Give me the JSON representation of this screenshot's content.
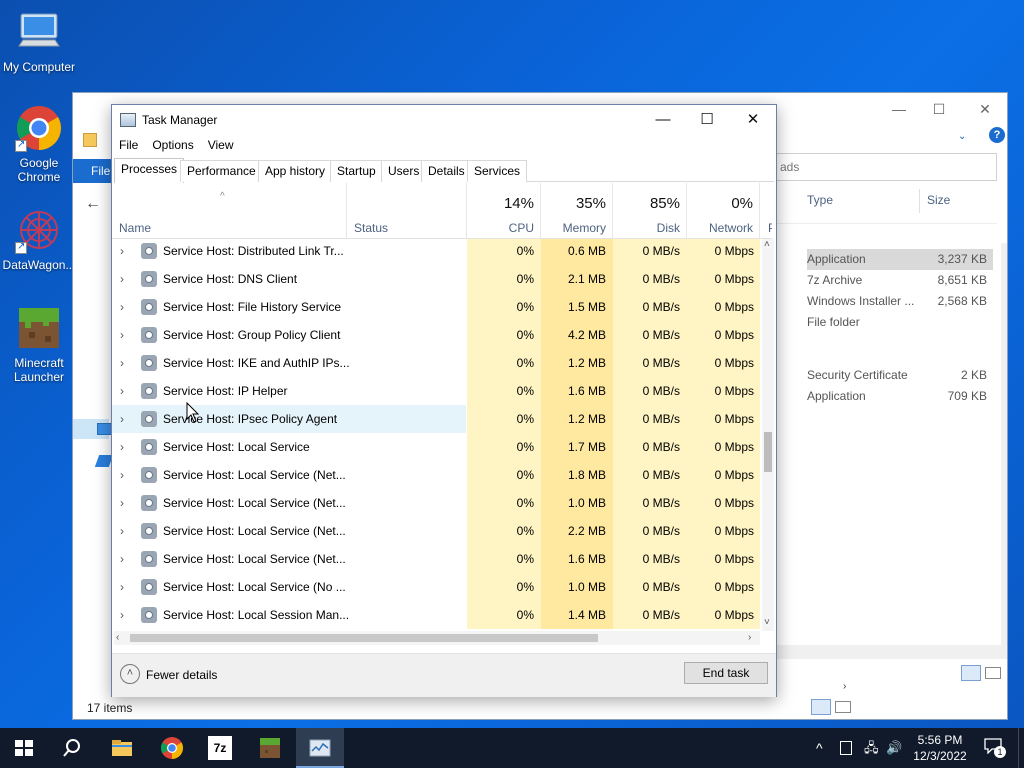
{
  "desktop": {
    "icons": [
      {
        "label": "My Computer",
        "icon": "computer-icon"
      },
      {
        "label": "Google Chrome",
        "icon": "chrome-icon"
      },
      {
        "label": "DataWagon...",
        "icon": "datawagon-icon"
      },
      {
        "label": "Minecraft Launcher",
        "icon": "minecraft-icon"
      }
    ]
  },
  "explorer": {
    "file_tab": "File",
    "search_placeholder": "ads",
    "columns": {
      "type": "Type",
      "size": "Size"
    },
    "rows": [
      {
        "type": "Application",
        "size": "3,237 KB",
        "selected": true
      },
      {
        "type": "7z Archive",
        "size": "8,651 KB"
      },
      {
        "type": "Windows Installer ...",
        "size": "2,568 KB"
      },
      {
        "type": "File folder",
        "size": ""
      },
      {
        "type": "Security Certificate",
        "size": "2 KB"
      },
      {
        "type": "Application",
        "size": "709 KB"
      }
    ],
    "status": "17 items"
  },
  "task_manager": {
    "title": "Task Manager",
    "menu": [
      "File",
      "Options",
      "View"
    ],
    "tabs": [
      "Processes",
      "Performance",
      "App history",
      "Startup",
      "Users",
      "Details",
      "Services"
    ],
    "active_tab": "Processes",
    "columns": {
      "name": "Name",
      "status": "Status",
      "cpu": {
        "pct": "14%",
        "label": "CPU"
      },
      "memory": {
        "pct": "35%",
        "label": "Memory"
      },
      "disk": {
        "pct": "85%",
        "label": "Disk"
      },
      "network": {
        "pct": "0%",
        "label": "Network"
      },
      "power": "P"
    },
    "rows": [
      {
        "name": "Service Host: Distributed Link Tr...",
        "cpu": "0%",
        "mem": "0.6 MB",
        "disk": "0 MB/s",
        "net": "0 Mbps"
      },
      {
        "name": "Service Host: DNS Client",
        "cpu": "0%",
        "mem": "2.1 MB",
        "disk": "0 MB/s",
        "net": "0 Mbps"
      },
      {
        "name": "Service Host: File History Service",
        "cpu": "0%",
        "mem": "1.5 MB",
        "disk": "0 MB/s",
        "net": "0 Mbps"
      },
      {
        "name": "Service Host: Group Policy Client",
        "cpu": "0%",
        "mem": "4.2 MB",
        "disk": "0 MB/s",
        "net": "0 Mbps"
      },
      {
        "name": "Service Host: IKE and AuthIP IPs...",
        "cpu": "0%",
        "mem": "1.2 MB",
        "disk": "0 MB/s",
        "net": "0 Mbps"
      },
      {
        "name": "Service Host: IP Helper",
        "cpu": "0%",
        "mem": "1.6 MB",
        "disk": "0 MB/s",
        "net": "0 Mbps"
      },
      {
        "name": "Service Host: IPsec Policy Agent",
        "cpu": "0%",
        "mem": "1.2 MB",
        "disk": "0 MB/s",
        "net": "0 Mbps",
        "hover": true
      },
      {
        "name": "Service Host: Local Service",
        "cpu": "0%",
        "mem": "1.7 MB",
        "disk": "0 MB/s",
        "net": "0 Mbps"
      },
      {
        "name": "Service Host: Local Service (Net...",
        "cpu": "0%",
        "mem": "1.8 MB",
        "disk": "0 MB/s",
        "net": "0 Mbps"
      },
      {
        "name": "Service Host: Local Service (Net...",
        "cpu": "0%",
        "mem": "1.0 MB",
        "disk": "0 MB/s",
        "net": "0 Mbps"
      },
      {
        "name": "Service Host: Local Service (Net...",
        "cpu": "0%",
        "mem": "2.2 MB",
        "disk": "0 MB/s",
        "net": "0 Mbps"
      },
      {
        "name": "Service Host: Local Service (Net...",
        "cpu": "0%",
        "mem": "1.6 MB",
        "disk": "0 MB/s",
        "net": "0 Mbps"
      },
      {
        "name": "Service Host: Local Service (No ...",
        "cpu": "0%",
        "mem": "1.0 MB",
        "disk": "0 MB/s",
        "net": "0 Mbps"
      },
      {
        "name": "Service Host: Local Session Man...",
        "cpu": "0%",
        "mem": "1.4 MB",
        "disk": "0 MB/s",
        "net": "0 Mbps"
      }
    ],
    "footer": {
      "fewer_details": "Fewer details",
      "end_task": "End task"
    }
  },
  "taskbar": {
    "apps": [
      "windows-start-icon",
      "search-icon",
      "file-explorer-icon",
      "chrome-icon",
      "7zip-icon",
      "minecraft-icon",
      "task-manager-icon"
    ],
    "sevenzip_label": "7z",
    "time": "5:56 PM",
    "date": "12/3/2022",
    "notification_count": "1"
  },
  "colors": {
    "cpu_bg": "#fff4c4",
    "memory_bg": "#ffe9a0",
    "hover": "#e5f3fb",
    "desktop": "#0a64d8",
    "taskbar": "#101a2a"
  }
}
